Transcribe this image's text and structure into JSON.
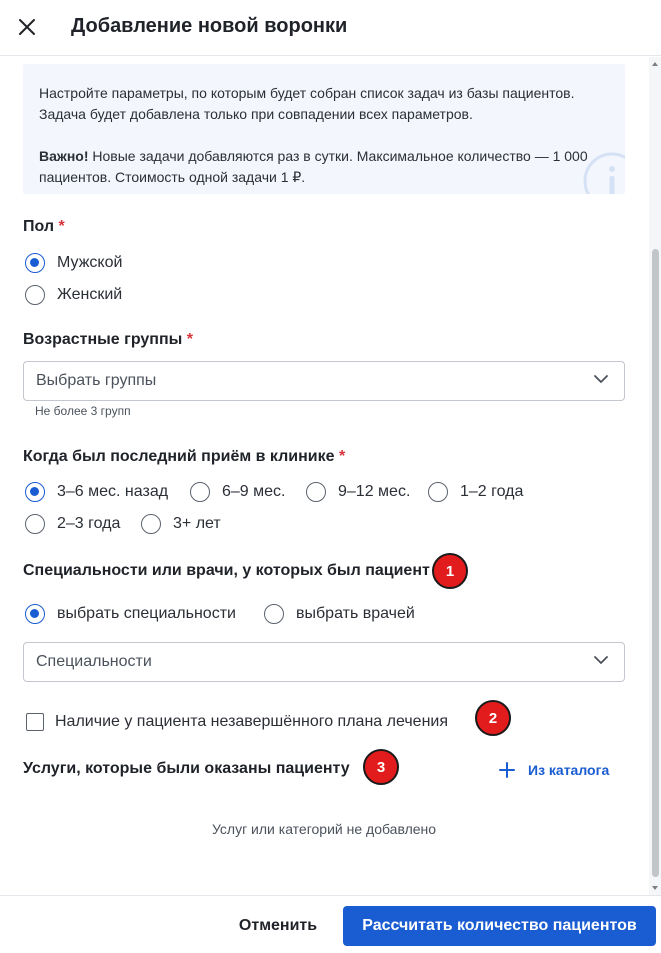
{
  "header": {
    "title": "Добавление новой воронки",
    "close_icon": "close-icon"
  },
  "info": {
    "text1": "Настройте параметры, по которым будет собран список задач из базы пациентов. Задача будет добавлена только при совпадении всех параметров.",
    "important_label": "Важно!",
    "text2": " Новые задачи добавляются раз в сутки. Максимальное количество — 1 000 пациентов. Стоимость одной задачи 1 ₽.",
    "icon": "info-icon"
  },
  "gender": {
    "label": "Пол",
    "required": "*",
    "options": [
      {
        "label": "Мужской",
        "selected": true
      },
      {
        "label": "Женский",
        "selected": false
      }
    ]
  },
  "age_groups": {
    "label": "Возрастные группы",
    "required": "*",
    "placeholder": "Выбрать группы",
    "hint": "Не более 3 групп"
  },
  "last_visit": {
    "label": "Когда был последний приём в клинике",
    "required": "*",
    "options": [
      {
        "label": "3–6 мес. назад",
        "selected": true
      },
      {
        "label": "6–9 мес.",
        "selected": false
      },
      {
        "label": "9–12 мес.",
        "selected": false
      },
      {
        "label": "1–2 года",
        "selected": false
      },
      {
        "label": "2–3 года",
        "selected": false
      },
      {
        "label": "3+ лет",
        "selected": false
      }
    ]
  },
  "specialties": {
    "label": "Специальности или врачи, у которых был пациент",
    "options": [
      {
        "label": "выбрать специальности",
        "selected": true
      },
      {
        "label": "выбрать врачей",
        "selected": false
      }
    ],
    "placeholder": "Специальности"
  },
  "treatment_plan": {
    "label": "Наличие у пациента незавершённого плана лечения",
    "checked": false
  },
  "services": {
    "label": "Услуги, которые были оказаны пациенту",
    "catalog_button": "Из каталога",
    "empty_text": "Услуг или категорий не добавлено"
  },
  "badges": [
    "1",
    "2",
    "3"
  ],
  "footer": {
    "cancel": "Отменить",
    "submit": "Рассчитать количество пациентов"
  },
  "colors": {
    "accent": "#1a5cd1",
    "required": "#d9343b",
    "badge": "#e21c1c",
    "info_bg": "#f3f6fc"
  }
}
